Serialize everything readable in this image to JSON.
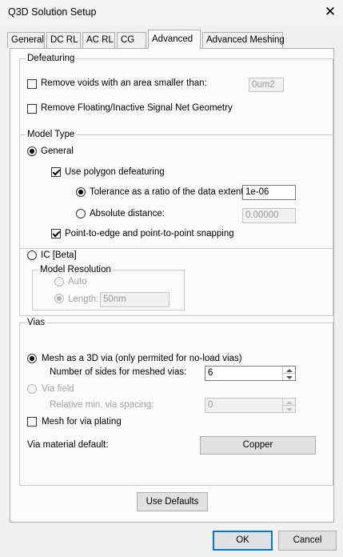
{
  "window": {
    "title": "Q3D Solution Setup"
  },
  "tabs": [
    {
      "label": "General"
    },
    {
      "label": "DC RL"
    },
    {
      "label": "AC RL"
    },
    {
      "label": "CG"
    },
    {
      "label": "Advanced",
      "active": true
    },
    {
      "label": "Advanced Meshing"
    }
  ],
  "defeaturing": {
    "legend": "Defeaturing",
    "remove_voids": {
      "label": "Remove voids with an area smaller than:",
      "checked": false,
      "value": "0um2"
    },
    "remove_floating": {
      "label": "Remove Floating/Inactive Signal Net Geometry",
      "checked": false
    }
  },
  "model_type": {
    "legend": "Model Type",
    "general": {
      "label": "General",
      "selected": true
    },
    "use_polygon": {
      "label": "Use polygon defeaturing",
      "checked": true
    },
    "tolerance": {
      "label": "Tolerance as a ratio of the data extent:",
      "selected": true,
      "value": "1e-06"
    },
    "absolute": {
      "label": "Absolute distance:",
      "selected": false,
      "value": "0.00000"
    },
    "snapping": {
      "label": "Point-to-edge and point-to-point snapping",
      "checked": true
    },
    "ic": {
      "label": "IC [Beta]",
      "selected": false
    },
    "model_resolution": {
      "legend": "Model Resolution",
      "auto": {
        "label": "Auto",
        "selected": false
      },
      "length": {
        "label": "Length:",
        "selected": true,
        "value": "50nm"
      }
    }
  },
  "vias": {
    "legend": "Vias",
    "mesh3d": {
      "label": "Mesh as a 3D via (only permited for no-load vias)",
      "selected": true
    },
    "num_sides": {
      "label": "Number of sides for meshed vias:",
      "value": "6"
    },
    "via_field": {
      "label": "Via field",
      "selected": false
    },
    "rel_spacing": {
      "label": "Relative min. via spacing:",
      "value": "0"
    },
    "mesh_plating": {
      "label": "Mesh for via plating",
      "checked": false
    },
    "material": {
      "label": "Via material default:",
      "button": "Copper"
    }
  },
  "buttons": {
    "use_defaults": "Use Defaults",
    "ok": "OK",
    "cancel": "Cancel"
  }
}
